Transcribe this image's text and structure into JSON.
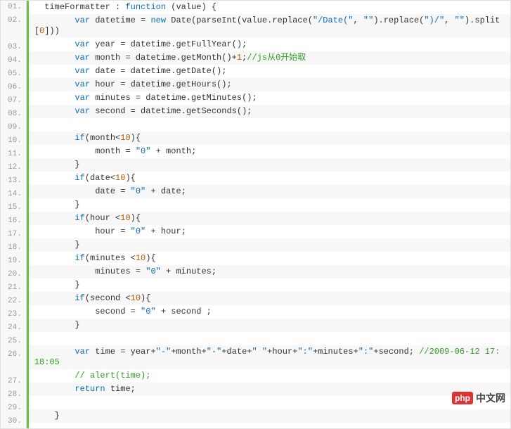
{
  "logo": {
    "badge": "php",
    "text": "中文网"
  },
  "lines": [
    {
      "n": "01.",
      "tokens": [
        [
          "",
          "  "
        ],
        [
          "fn",
          "timeFormatter"
        ],
        [
          "",
          " : "
        ],
        [
          "kw",
          "function"
        ],
        [
          "",
          " (value) {"
        ]
      ]
    },
    {
      "n": "02.",
      "tall": true,
      "tokens": [
        [
          "",
          "        "
        ],
        [
          "kw",
          "var"
        ],
        [
          "",
          " datetime = "
        ],
        [
          "kw",
          "new"
        ],
        [
          "",
          " Date(parseInt(value.replace("
        ],
        [
          "str",
          "\"/Date(\""
        ],
        [
          "",
          ", "
        ],
        [
          "str",
          "\"\""
        ],
        [
          "",
          ").replace("
        ],
        [
          "str",
          "\")/\""
        ],
        [
          "",
          ", "
        ],
        [
          "str",
          "\"\""
        ],
        [
          "",
          ").split["
        ],
        [
          "num",
          "0"
        ],
        [
          "",
          "]))"
        ]
      ]
    },
    {
      "n": "03.",
      "tokens": [
        [
          "",
          "        "
        ],
        [
          "kw",
          "var"
        ],
        [
          "",
          " year = datetime.getFullYear();"
        ]
      ]
    },
    {
      "n": "04.",
      "tokens": [
        [
          "",
          "        "
        ],
        [
          "kw",
          "var"
        ],
        [
          "",
          " month = datetime.getMonth()+"
        ],
        [
          "num",
          "1"
        ],
        [
          "",
          ";"
        ],
        [
          "cmt",
          "//js从0开始取"
        ]
      ]
    },
    {
      "n": "05.",
      "tokens": [
        [
          "",
          "        "
        ],
        [
          "kw",
          "var"
        ],
        [
          "",
          " date = datetime.getDate();"
        ]
      ]
    },
    {
      "n": "06.",
      "tokens": [
        [
          "",
          "        "
        ],
        [
          "kw",
          "var"
        ],
        [
          "",
          " hour = datetime.getHours();"
        ]
      ]
    },
    {
      "n": "07.",
      "tokens": [
        [
          "",
          "        "
        ],
        [
          "kw",
          "var"
        ],
        [
          "",
          " minutes = datetime.getMinutes();"
        ]
      ]
    },
    {
      "n": "08.",
      "tokens": [
        [
          "",
          "        "
        ],
        [
          "kw",
          "var"
        ],
        [
          "",
          " second = datetime.getSeconds();"
        ]
      ]
    },
    {
      "n": "09.",
      "tokens": [
        [
          "",
          ""
        ]
      ]
    },
    {
      "n": "10.",
      "tokens": [
        [
          "",
          "        "
        ],
        [
          "kw",
          "if"
        ],
        [
          "",
          "(month<"
        ],
        [
          "num",
          "10"
        ],
        [
          "",
          "){"
        ]
      ]
    },
    {
      "n": "11.",
      "tokens": [
        [
          "",
          "            month = "
        ],
        [
          "str",
          "\"0\""
        ],
        [
          "",
          " + month;"
        ]
      ]
    },
    {
      "n": "12.",
      "tokens": [
        [
          "",
          "        }"
        ]
      ]
    },
    {
      "n": "13.",
      "tokens": [
        [
          "",
          "        "
        ],
        [
          "kw",
          "if"
        ],
        [
          "",
          "(date<"
        ],
        [
          "num",
          "10"
        ],
        [
          "",
          "){"
        ]
      ]
    },
    {
      "n": "14.",
      "tokens": [
        [
          "",
          "            date = "
        ],
        [
          "str",
          "\"0\""
        ],
        [
          "",
          " + date;"
        ]
      ]
    },
    {
      "n": "15.",
      "tokens": [
        [
          "",
          "        }"
        ]
      ]
    },
    {
      "n": "16.",
      "tokens": [
        [
          "",
          "        "
        ],
        [
          "kw",
          "if"
        ],
        [
          "",
          "(hour <"
        ],
        [
          "num",
          "10"
        ],
        [
          "",
          "){"
        ]
      ]
    },
    {
      "n": "17.",
      "tokens": [
        [
          "",
          "            hour = "
        ],
        [
          "str",
          "\"0\""
        ],
        [
          "",
          " + hour;"
        ]
      ]
    },
    {
      "n": "18.",
      "tokens": [
        [
          "",
          "        }"
        ]
      ]
    },
    {
      "n": "19.",
      "tokens": [
        [
          "",
          "        "
        ],
        [
          "kw",
          "if"
        ],
        [
          "",
          "(minutes <"
        ],
        [
          "num",
          "10"
        ],
        [
          "",
          "){"
        ]
      ]
    },
    {
      "n": "20.",
      "tokens": [
        [
          "",
          "            minutes = "
        ],
        [
          "str",
          "\"0\""
        ],
        [
          "",
          " + minutes;"
        ]
      ]
    },
    {
      "n": "21.",
      "tokens": [
        [
          "",
          "        }"
        ]
      ]
    },
    {
      "n": "22.",
      "tokens": [
        [
          "",
          "        "
        ],
        [
          "kw",
          "if"
        ],
        [
          "",
          "(second <"
        ],
        [
          "num",
          "10"
        ],
        [
          "",
          "){"
        ]
      ]
    },
    {
      "n": "23.",
      "tokens": [
        [
          "",
          "            second = "
        ],
        [
          "str",
          "\"0\""
        ],
        [
          "",
          " + second ;"
        ]
      ]
    },
    {
      "n": "24.",
      "tokens": [
        [
          "",
          "        }"
        ]
      ]
    },
    {
      "n": "25.",
      "tokens": [
        [
          "",
          ""
        ]
      ]
    },
    {
      "n": "26.",
      "tall": true,
      "tokens": [
        [
          "",
          "        "
        ],
        [
          "kw",
          "var"
        ],
        [
          "",
          " time = year+"
        ],
        [
          "str",
          "\"-\""
        ],
        [
          "",
          "+month+"
        ],
        [
          "str",
          "\"-\""
        ],
        [
          "",
          "+date+"
        ],
        [
          "str",
          "\" \""
        ],
        [
          "",
          "+hour+"
        ],
        [
          "str",
          "\":\""
        ],
        [
          "",
          "+minutes+"
        ],
        [
          "str",
          "\":\""
        ],
        [
          "",
          "+second; "
        ],
        [
          "cmt",
          "//2009-06-12 17:18:05"
        ]
      ]
    },
    {
      "n": "27.",
      "tokens": [
        [
          "",
          "        "
        ],
        [
          "cmt",
          "// alert(time);"
        ]
      ]
    },
    {
      "n": "28.",
      "tokens": [
        [
          "",
          "        "
        ],
        [
          "kw",
          "return"
        ],
        [
          "",
          " time;"
        ]
      ]
    },
    {
      "n": "29.",
      "tokens": [
        [
          "",
          ""
        ]
      ]
    },
    {
      "n": "30.",
      "tokens": [
        [
          "",
          "    }"
        ]
      ]
    }
  ]
}
